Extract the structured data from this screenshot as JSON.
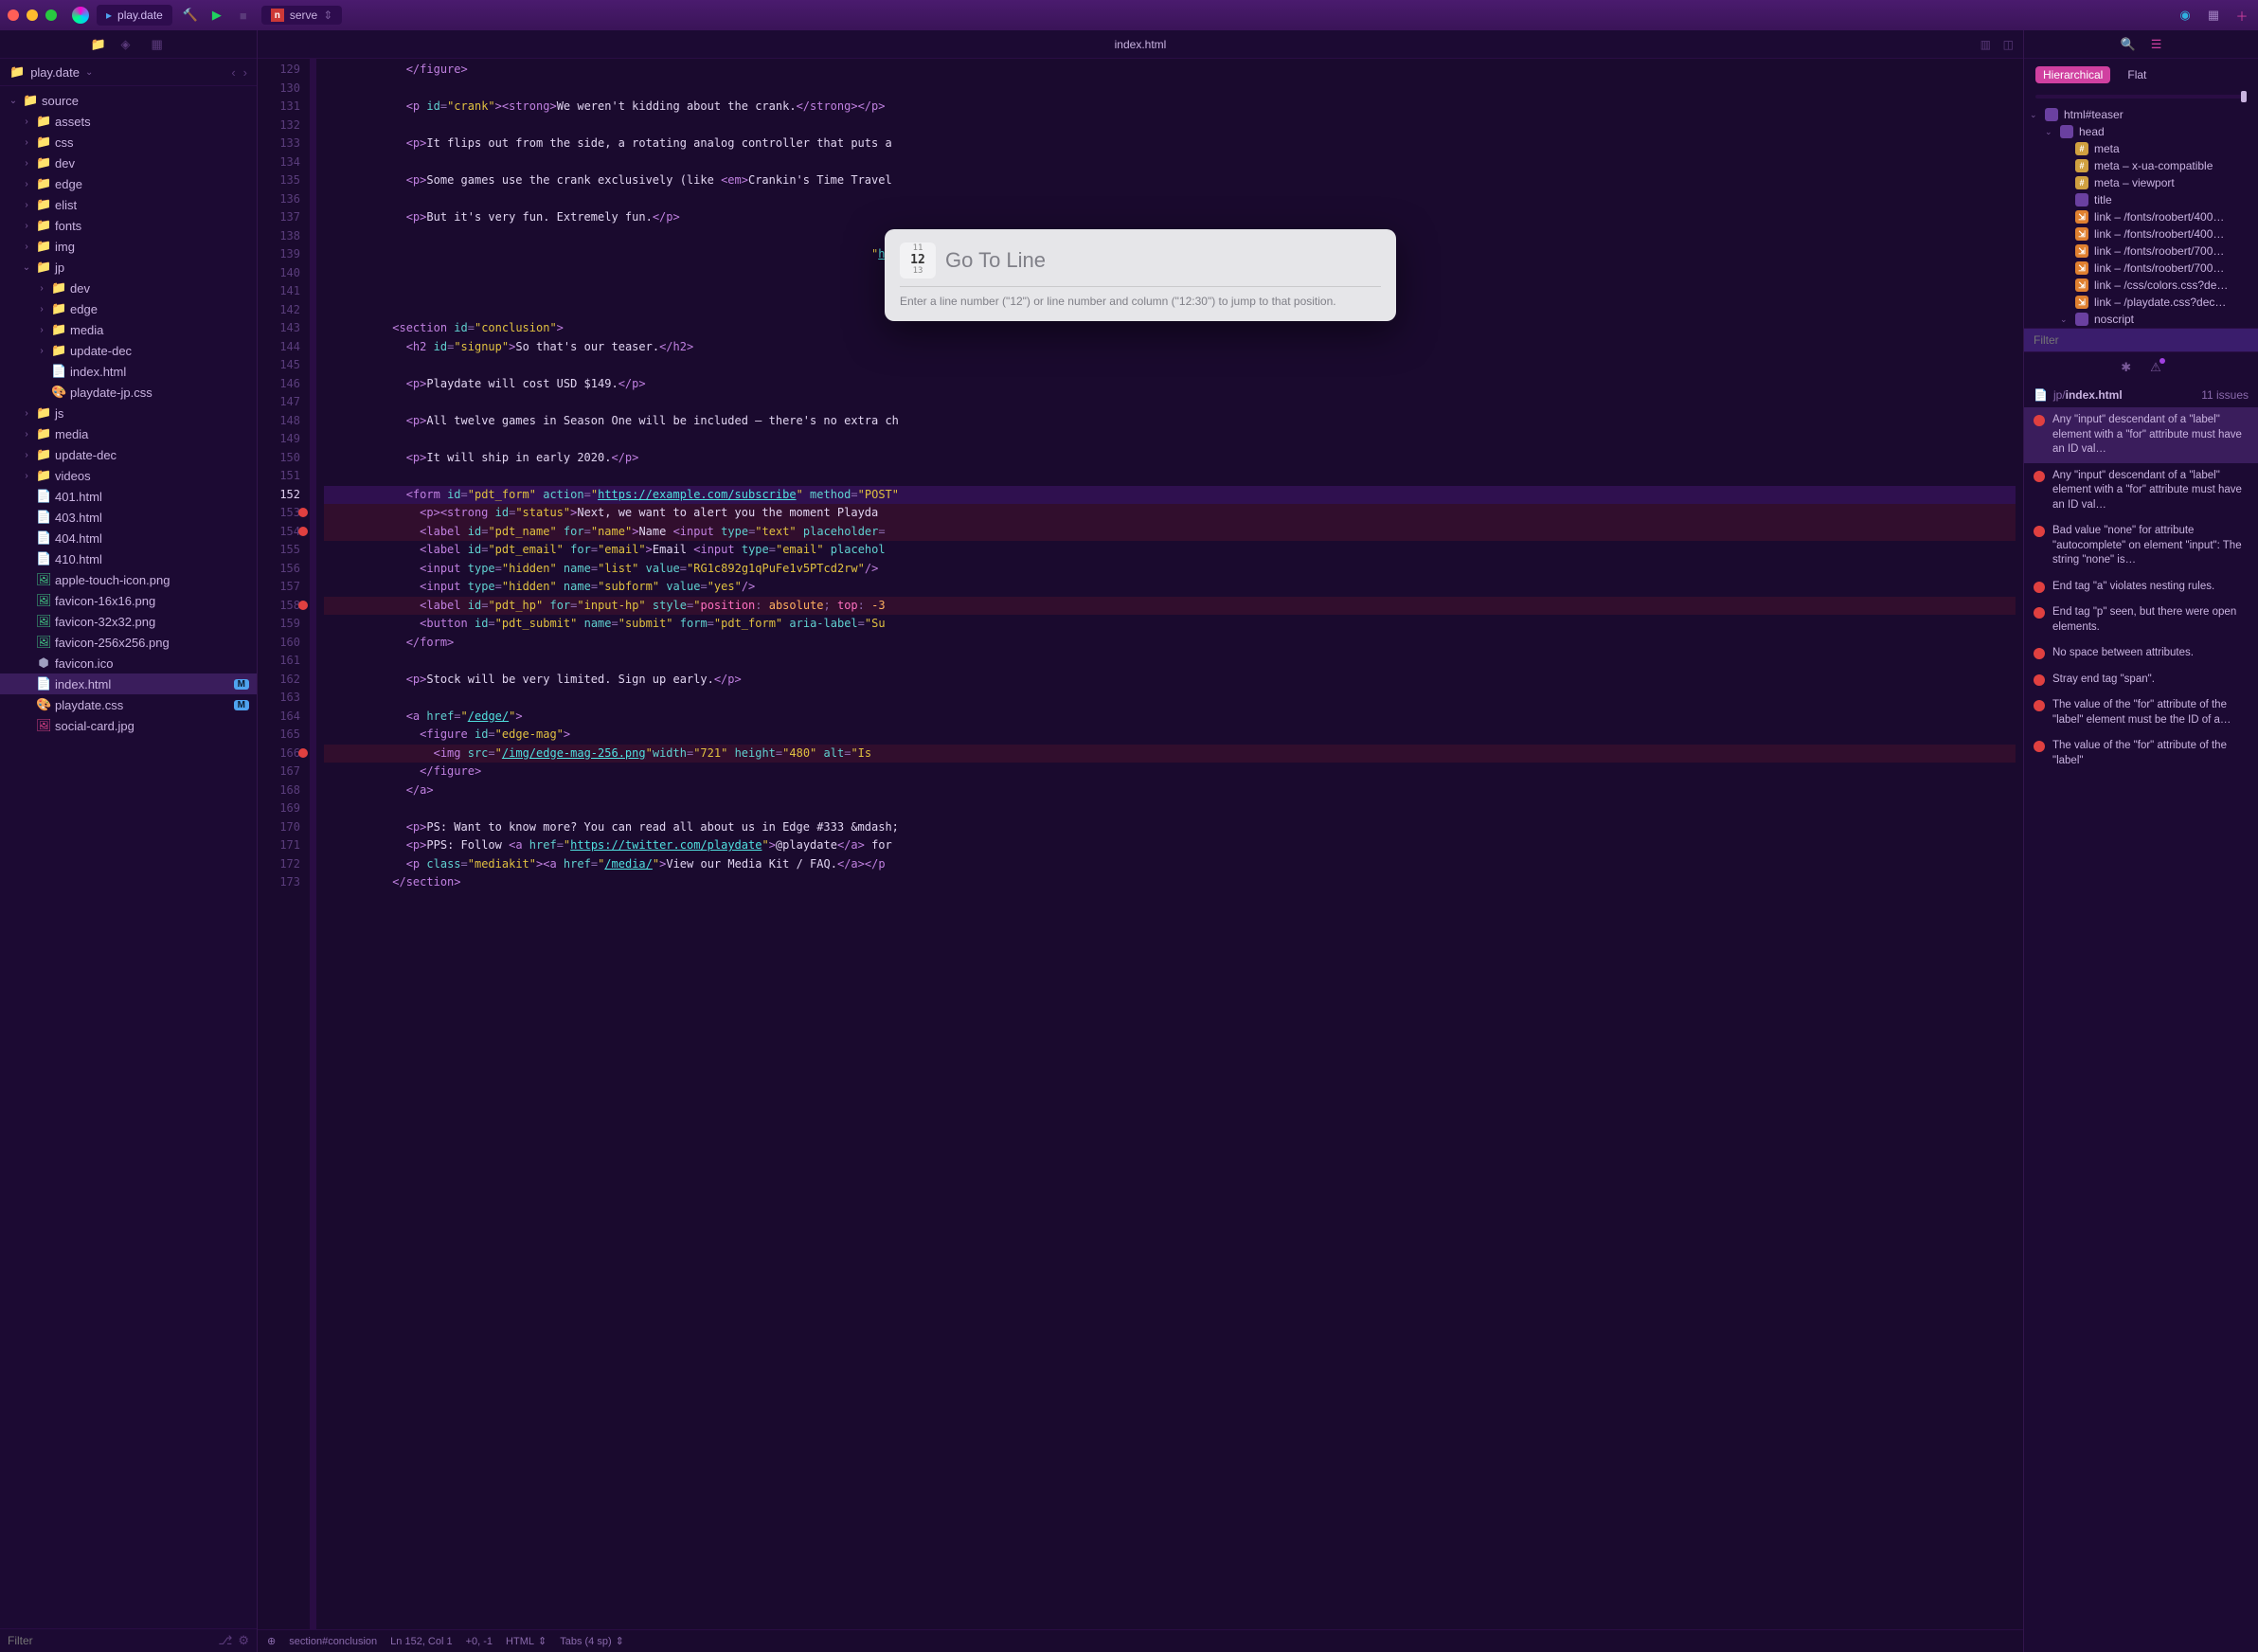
{
  "window": {
    "tab_title": "play.date",
    "serve_label": "serve",
    "editor_title": "index.html"
  },
  "project": {
    "root": "play.date",
    "tree": [
      {
        "d": 0,
        "open": true,
        "type": "folder",
        "name": "source"
      },
      {
        "d": 1,
        "closed": true,
        "type": "folder",
        "name": "assets"
      },
      {
        "d": 1,
        "closed": true,
        "type": "folder",
        "name": "css"
      },
      {
        "d": 1,
        "closed": true,
        "type": "folder",
        "name": "dev"
      },
      {
        "d": 1,
        "closed": true,
        "type": "folder",
        "name": "edge"
      },
      {
        "d": 1,
        "closed": true,
        "type": "folder",
        "name": "elist"
      },
      {
        "d": 1,
        "closed": true,
        "type": "folder",
        "name": "fonts"
      },
      {
        "d": 1,
        "closed": true,
        "type": "folder",
        "name": "img"
      },
      {
        "d": 1,
        "open": true,
        "type": "folder",
        "name": "jp"
      },
      {
        "d": 2,
        "closed": true,
        "type": "folder",
        "name": "dev"
      },
      {
        "d": 2,
        "closed": true,
        "type": "folder",
        "name": "edge"
      },
      {
        "d": 2,
        "closed": true,
        "type": "folder",
        "name": "media"
      },
      {
        "d": 2,
        "closed": true,
        "type": "folder",
        "name": "update-dec"
      },
      {
        "d": 2,
        "type": "html",
        "name": "index.html"
      },
      {
        "d": 2,
        "type": "css",
        "name": "playdate-jp.css"
      },
      {
        "d": 1,
        "closed": true,
        "type": "folder",
        "name": "js"
      },
      {
        "d": 1,
        "closed": true,
        "type": "folder",
        "name": "media"
      },
      {
        "d": 1,
        "closed": true,
        "type": "folder",
        "name": "update-dec"
      },
      {
        "d": 1,
        "closed": true,
        "type": "folder",
        "name": "videos"
      },
      {
        "d": 1,
        "type": "html",
        "name": "401.html"
      },
      {
        "d": 1,
        "type": "html",
        "name": "403.html"
      },
      {
        "d": 1,
        "type": "html",
        "name": "404.html"
      },
      {
        "d": 1,
        "type": "html",
        "name": "410.html"
      },
      {
        "d": 1,
        "type": "png",
        "name": "apple-touch-icon.png"
      },
      {
        "d": 1,
        "type": "png",
        "name": "favicon-16x16.png"
      },
      {
        "d": 1,
        "type": "png",
        "name": "favicon-32x32.png"
      },
      {
        "d": 1,
        "type": "png",
        "name": "favicon-256x256.png"
      },
      {
        "d": 1,
        "type": "ico",
        "name": "favicon.ico"
      },
      {
        "d": 1,
        "type": "html",
        "name": "index.html",
        "selected": true,
        "badge": "M"
      },
      {
        "d": 1,
        "type": "css",
        "name": "playdate.css",
        "badge": "M"
      },
      {
        "d": 1,
        "type": "jpg",
        "name": "social-card.jpg"
      }
    ],
    "filter_placeholder": "Filter"
  },
  "editor": {
    "first_line": 129,
    "current_line": 152,
    "lines": [
      {
        "n": 129,
        "html": "            <span class='tag'>&lt;/figure&gt;</span>"
      },
      {
        "n": 130,
        "html": ""
      },
      {
        "n": 131,
        "html": "            <span class='tag'>&lt;p</span> <span class='attr'>id</span>=<span class='str'>\"crank\"</span><span class='tag'>&gt;&lt;strong&gt;</span><span class='txt'>We weren't kidding about the crank.</span><span class='tag'>&lt;/strong&gt;&lt;/p&gt;</span>"
      },
      {
        "n": 132,
        "html": ""
      },
      {
        "n": 133,
        "html": "            <span class='tag'>&lt;p&gt;</span><span class='txt'>It flips out from the side, a rotating analog controller that puts a </span>"
      },
      {
        "n": 134,
        "html": ""
      },
      {
        "n": 135,
        "html": "            <span class='tag'>&lt;p&gt;</span><span class='txt'>Some games use the crank exclusively (like </span><span class='tag'>&lt;em&gt;</span><span class='txt'>Crankin's Time Travel</span>"
      },
      {
        "n": 136,
        "html": ""
      },
      {
        "n": 137,
        "html": "            <span class='tag'>&lt;p&gt;</span><span class='txt'>But it's very fun. Extremely fun.</span><span class='tag'>&lt;/p&gt;</span>"
      },
      {
        "n": 138,
        "html": ""
      },
      {
        "n": 139,
        "html": "                                                                                <span class='str'>\"</span><span class='url'>https://teena</span>"
      },
      {
        "n": 140,
        "html": ""
      },
      {
        "n": 141,
        "html": ""
      },
      {
        "n": 142,
        "html": ""
      },
      {
        "n": 143,
        "html": "          <span class='tag'>&lt;section</span> <span class='attr'>id</span>=<span class='str'>\"conclusion\"</span><span class='tag'>&gt;</span>"
      },
      {
        "n": 144,
        "html": "            <span class='tag'>&lt;h2</span> <span class='attr'>id</span>=<span class='str'>\"signup\"</span><span class='tag'>&gt;</span><span class='txt'>So that's our teaser.</span><span class='tag'>&lt;/h2&gt;</span>"
      },
      {
        "n": 145,
        "html": ""
      },
      {
        "n": 146,
        "html": "            <span class='tag'>&lt;p&gt;</span><span class='txt'>Playdate will cost USD $149.</span><span class='tag'>&lt;/p&gt;</span>"
      },
      {
        "n": 147,
        "html": ""
      },
      {
        "n": 148,
        "html": "            <span class='tag'>&lt;p&gt;</span><span class='txt'>All twelve games in Season One will be included — there's no extra ch</span>"
      },
      {
        "n": 149,
        "html": ""
      },
      {
        "n": 150,
        "html": "            <span class='tag'>&lt;p&gt;</span><span class='txt'>It will ship in early 2020.</span><span class='tag'>&lt;/p&gt;</span>"
      },
      {
        "n": 151,
        "html": ""
      },
      {
        "n": 152,
        "html": "            <span class='tag'>&lt;form</span> <span class='attr'>id</span>=<span class='str'>\"pdt_form\"</span> <span class='attr'>action</span>=<span class='str'>\"</span><span class='url'>https://example.com/subscribe</span><span class='str'>\"</span> <span class='attr'>method</span>=<span class='str'>\"POST\"</span>",
        "hl": true
      },
      {
        "n": 153,
        "html": "              <span class='tag'>&lt;p&gt;&lt;strong</span> <span class='attr'>id</span>=<span class='str'>\"status\"</span><span class='tag'>&gt;</span><span class='txt'>Next, we want to alert you the moment Playda</span>",
        "err": true
      },
      {
        "n": 154,
        "html": "              <span class='tag'>&lt;label</span> <span class='attr'>id</span>=<span class='str'>\"pdt_name\"</span> <span class='attr'>for</span>=<span class='str'>\"name\"</span><span class='tag'>&gt;</span><span class='txt'>Name </span><span class='tag'>&lt;input</span> <span class='attr'>type</span>=<span class='str'>\"text\"</span> <span class='attr'>placeholder</span>=",
        "err": true
      },
      {
        "n": 155,
        "html": "              <span class='tag'>&lt;label</span> <span class='attr'>id</span>=<span class='str'>\"pdt_email\"</span> <span class='attr'>for</span>=<span class='str'>\"email\"</span><span class='tag'>&gt;</span><span class='txt'>Email </span><span class='tag'>&lt;input</span> <span class='attr'>type</span>=<span class='str'>\"email\"</span> <span class='attr'>placehol</span>"
      },
      {
        "n": 156,
        "html": "              <span class='tag'>&lt;input</span> <span class='attr'>type</span>=<span class='str'>\"hidden\"</span> <span class='attr'>name</span>=<span class='str'>\"list\"</span> <span class='attr'>value</span>=<span class='str'>\"RG1c892g1qPuFe1v5PTcd2rw\"</span><span class='tag'>/&gt;</span>"
      },
      {
        "n": 157,
        "html": "              <span class='tag'>&lt;input</span> <span class='attr'>type</span>=<span class='str'>\"hidden\"</span> <span class='attr'>name</span>=<span class='str'>\"subform\"</span> <span class='attr'>value</span>=<span class='str'>\"yes\"</span><span class='tag'>/&gt;</span>"
      },
      {
        "n": 158,
        "html": "              <span class='tag'>&lt;label</span> <span class='attr'>id</span>=<span class='str'>\"pdt_hp\"</span> <span class='attr'>for</span>=<span class='str'>\"input-hp\"</span> <span class='attr'>style</span>=<span class='str'>\"</span><span class='kw'>position</span>: <span class='num'>absolute</span>; <span class='kw'>top</span>: <span class='num'>-3</span>",
        "err": true
      },
      {
        "n": 159,
        "html": "              <span class='tag'>&lt;button</span> <span class='attr'>id</span>=<span class='str'>\"pdt_submit\"</span> <span class='attr'>name</span>=<span class='str'>\"submit\"</span> <span class='attr'>form</span>=<span class='str'>\"pdt_form\"</span> <span class='attr'>aria-label</span>=<span class='str'>\"Su</span>"
      },
      {
        "n": 160,
        "html": "            <span class='tag'>&lt;/form&gt;</span>"
      },
      {
        "n": 161,
        "html": ""
      },
      {
        "n": 162,
        "html": "            <span class='tag'>&lt;p&gt;</span><span class='txt'>Stock will be very limited. Sign up early.</span><span class='tag'>&lt;/p&gt;</span>"
      },
      {
        "n": 163,
        "html": ""
      },
      {
        "n": 164,
        "html": "            <span class='tag'>&lt;a</span> <span class='attr'>href</span>=<span class='str'>\"</span><span class='url'>/edge/</span><span class='str'>\"</span><span class='tag'>&gt;</span>"
      },
      {
        "n": 165,
        "html": "              <span class='tag'>&lt;figure</span> <span class='attr'>id</span>=<span class='str'>\"edge-mag\"</span><span class='tag'>&gt;</span>"
      },
      {
        "n": 166,
        "html": "                <span class='tag'>&lt;img</span> <span class='attr'>src</span>=<span class='str'>\"</span><span class='url'>/img/edge-mag-256.png</span><span class='str'>\"</span><span class='attr'>width</span>=<span class='str'>\"721\"</span> <span class='attr'>height</span>=<span class='str'>\"480\"</span> <span class='attr'>alt</span>=<span class='str'>\"Is</span>",
        "err": true
      },
      {
        "n": 167,
        "html": "              <span class='tag'>&lt;/figure&gt;</span>"
      },
      {
        "n": 168,
        "html": "            <span class='tag'>&lt;/a&gt;</span>"
      },
      {
        "n": 169,
        "html": ""
      },
      {
        "n": 170,
        "html": "            <span class='tag'>&lt;p&gt;</span><span class='txt'>PS: Want to know more? You can read all about us in Edge #333 &amp;mdash;</span>"
      },
      {
        "n": 171,
        "html": "            <span class='tag'>&lt;p&gt;</span><span class='txt'>PPS: Follow </span><span class='tag'>&lt;a</span> <span class='attr'>href</span>=<span class='str'>\"</span><span class='url'>https://twitter.com/playdate</span><span class='str'>\"</span><span class='tag'>&gt;</span><span class='txt'>@playdate</span><span class='tag'>&lt;/a&gt;</span><span class='txt'> for</span>"
      },
      {
        "n": 172,
        "html": "            <span class='tag'>&lt;p</span> <span class='attr'>class</span>=<span class='str'>\"mediakit\"</span><span class='tag'>&gt;&lt;a</span> <span class='attr'>href</span>=<span class='str'>\"</span><span class='url'>/media/</span><span class='str'>\"</span><span class='tag'>&gt;</span><span class='txt'>View our Media Kit / FAQ.</span><span class='tag'>&lt;/a&gt;&lt;/p</span>"
      },
      {
        "n": 173,
        "html": "          <span class='tag'>&lt;/section&gt;</span>"
      }
    ]
  },
  "statusbar": {
    "breadcrumb": "section#conclusion",
    "position": "Ln 152, Col 1",
    "diff": "+0, -1",
    "lang": "HTML",
    "indent": "Tabs (4 sp)"
  },
  "goto": {
    "title": "Go To Line",
    "hint": "Enter a line number (\"12\") or line number and column (\"12:30\") to jump to that position.",
    "icon_lines": [
      "11",
      "12",
      "13"
    ]
  },
  "inspector": {
    "toggle_hierarchical": "Hierarchical",
    "toggle_flat": "Flat",
    "dom": [
      {
        "d": 0,
        "open": true,
        "ico": "tag",
        "label": "html#teaser"
      },
      {
        "d": 1,
        "open": true,
        "ico": "tag",
        "label": "head"
      },
      {
        "d": 2,
        "ico": "hash",
        "label": "meta"
      },
      {
        "d": 2,
        "ico": "hash",
        "label": "meta – x-ua-compatible"
      },
      {
        "d": 2,
        "ico": "hash",
        "label": "meta – viewport"
      },
      {
        "d": 2,
        "ico": "tag",
        "label": "title"
      },
      {
        "d": 2,
        "ico": "link",
        "label": "link – /fonts/roobert/400…"
      },
      {
        "d": 2,
        "ico": "link",
        "label": "link – /fonts/roobert/400…"
      },
      {
        "d": 2,
        "ico": "link",
        "label": "link – /fonts/roobert/700…"
      },
      {
        "d": 2,
        "ico": "link",
        "label": "link – /fonts/roobert/700…"
      },
      {
        "d": 2,
        "ico": "link",
        "label": "link – /css/colors.css?de…"
      },
      {
        "d": 2,
        "ico": "link",
        "label": "link – /playdate.css?dec…"
      },
      {
        "d": 2,
        "open": true,
        "ico": "tag",
        "label": "noscript"
      }
    ],
    "dom_filter_placeholder": "Filter",
    "issues_path": "jp/index.html",
    "issues_count": "11 issues",
    "issues": [
      {
        "msg": "Any \"input\" descendant of a \"label\" element with a \"for\" attribute must have an ID val…",
        "sel": true
      },
      {
        "msg": "Any \"input\" descendant of a \"label\" element with a \"for\" attribute must have an ID val…"
      },
      {
        "msg": "Bad value \"none\" for attribute \"autocomplete\" on element \"input\": The string \"none\" is…"
      },
      {
        "msg": "End tag \"a\" violates nesting rules."
      },
      {
        "msg": "End tag \"p\" seen, but there were open elements."
      },
      {
        "msg": "No space between attributes."
      },
      {
        "msg": "Stray end tag \"span\"."
      },
      {
        "msg": "The value of the \"for\" attribute of the \"label\" element must be the ID of a…"
      },
      {
        "msg": "The value of the \"for\" attribute of the \"label\""
      }
    ]
  }
}
